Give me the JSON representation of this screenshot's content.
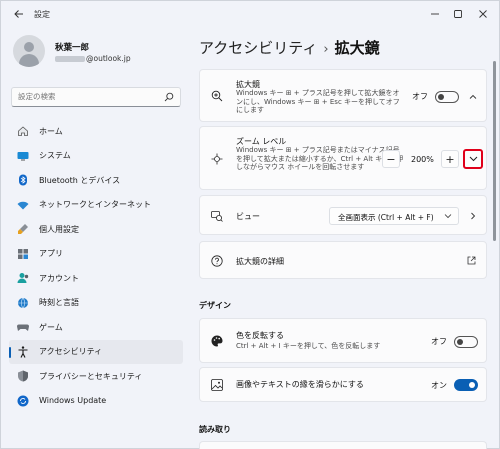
{
  "app": {
    "title": "設定"
  },
  "profile": {
    "name": "秋葉一郎",
    "email_suffix": "@outlook.jp"
  },
  "search": {
    "placeholder": "設定の検索"
  },
  "sidebar": {
    "items": [
      {
        "label": "ホーム",
        "icon": "home-icon"
      },
      {
        "label": "システム",
        "icon": "display-icon"
      },
      {
        "label": "Bluetooth とデバイス",
        "icon": "bluetooth-icon"
      },
      {
        "label": "ネットワークとインターネット",
        "icon": "wifi-icon"
      },
      {
        "label": "個人用設定",
        "icon": "brush-icon"
      },
      {
        "label": "アプリ",
        "icon": "apps-icon"
      },
      {
        "label": "アカウント",
        "icon": "account-icon"
      },
      {
        "label": "時刻と言語",
        "icon": "globe-clock-icon"
      },
      {
        "label": "ゲーム",
        "icon": "gamepad-icon"
      },
      {
        "label": "アクセシビリティ",
        "icon": "accessibility-icon",
        "active": true
      },
      {
        "label": "プライバシーとセキュリティ",
        "icon": "shield-icon"
      },
      {
        "label": "Windows Update",
        "icon": "update-icon"
      }
    ]
  },
  "header": {
    "parent": "アクセシビリティ",
    "separator": "›",
    "current": "拡大鏡"
  },
  "magnifier": {
    "title": "拡大鏡",
    "desc": "Windows キー ⊞ + プラス記号を押して拡大鏡をオンにし、Windows キー ⊞ + Esc キーを押してオフにします",
    "state_label": "オフ",
    "on": false
  },
  "zoom": {
    "title": "ズーム レベル",
    "desc": "Windows キー ⊞ + プラス記号またはマイナス記号を押して拡大または縮小するか、Ctrl + Alt キーを押しながらマウス ホイールを回転させます",
    "minus_label": "−",
    "value": "200%",
    "plus_label": "+"
  },
  "view": {
    "title": "ビュー",
    "selected": "全画面表示 (Ctrl + Alt + F)"
  },
  "details": {
    "title": "拡大鏡の詳細"
  },
  "design": {
    "section_title": "デザイン"
  },
  "invert": {
    "title": "色を反転する",
    "desc": "Ctrl + Alt + I キーを押して、色を反転します",
    "state_label": "オフ",
    "on": false
  },
  "smooth": {
    "title": "画像やテキストの縁を滑らかにする",
    "state_label": "オン",
    "on": true
  },
  "reading": {
    "section_title": "読み取り"
  },
  "colors": {
    "accent": "#0a5fb4",
    "highlight": "#e0001a"
  }
}
